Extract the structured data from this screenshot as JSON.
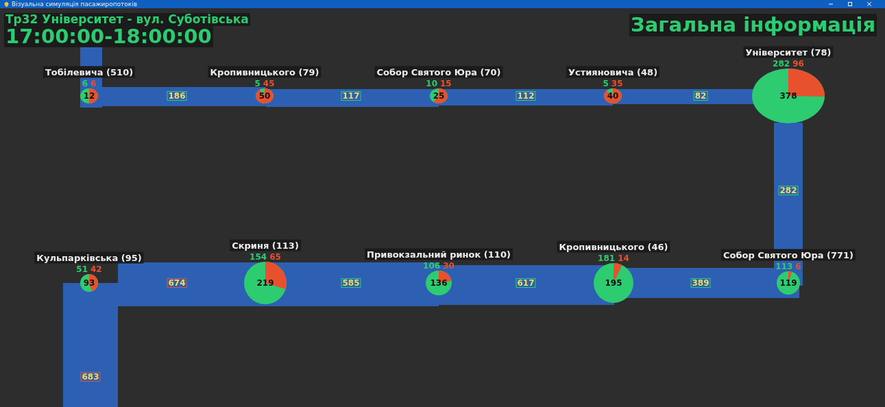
{
  "window": {
    "title": "Візуальна симуляція пасажиропотоків"
  },
  "route": "Тр32 Університет - вул. Суботівська",
  "time_range": "17:00:00-18:00:00",
  "info_title": "Загальна інформація",
  "stops": [
    {
      "name": "Тобілевича (510)",
      "boarding": "6",
      "alighting": "6",
      "total": "12"
    },
    {
      "name": "Кропивницького (79)",
      "boarding": "5",
      "alighting": "45",
      "total": "50"
    },
    {
      "name": "Собор Святого Юра (70)",
      "boarding": "10",
      "alighting": "15",
      "total": "25"
    },
    {
      "name": "Устияновича (48)",
      "boarding": "5",
      "alighting": "35",
      "total": "40"
    },
    {
      "name": "Університет (78)",
      "boarding": "282",
      "alighting": "96",
      "total": "378"
    },
    {
      "name": "Кульпарківська (95)",
      "boarding": "51",
      "alighting": "42",
      "total": "93"
    },
    {
      "name": "Скриня (113)",
      "boarding": "154",
      "alighting": "65",
      "total": "219"
    },
    {
      "name": "Привокзальний ринок (110)",
      "boarding": "106",
      "alighting": "30",
      "total": "136"
    },
    {
      "name": "Кропивницького (46)",
      "boarding": "181",
      "alighting": "14",
      "total": "195"
    },
    {
      "name": "Собор Святого Юра (771)",
      "boarding": "113",
      "alighting": "6",
      "total": "119"
    }
  ],
  "segments": [
    {
      "load": "186",
      "color": "#2ecc71"
    },
    {
      "load": "117",
      "color": "#2ecc71"
    },
    {
      "load": "112",
      "color": "#2ecc71"
    },
    {
      "load": "82",
      "color": "#2ecc71"
    },
    {
      "load": "282",
      "color": "#2ecc71"
    },
    {
      "load": "674",
      "color": "#e8512d"
    },
    {
      "load": "585",
      "color": "#2ecc71"
    },
    {
      "load": "617",
      "color": "#2ecc71"
    },
    {
      "load": "389",
      "color": "#2ecc71"
    },
    {
      "load": "683",
      "color": "#e8512d"
    }
  ]
}
